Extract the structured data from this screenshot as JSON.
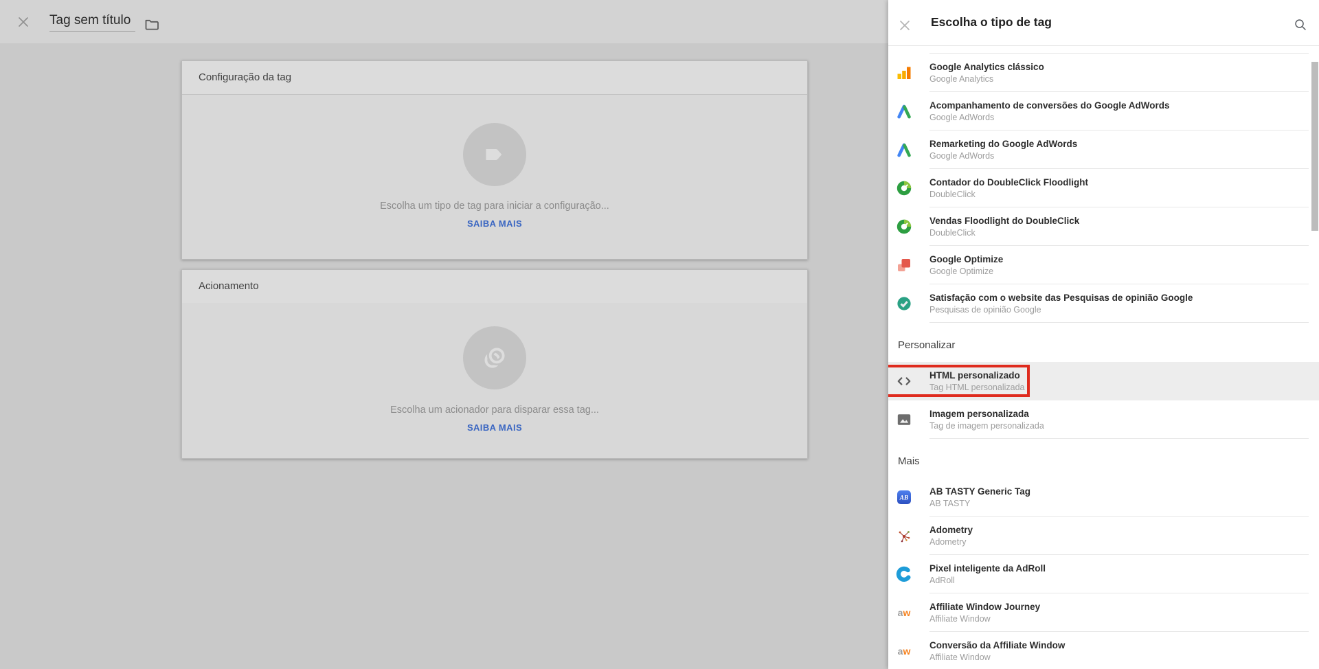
{
  "colors": {
    "accent_blue": "#3a66c2",
    "annotation_red": "#df2b1e",
    "highlight_row_bg": "#ededed"
  },
  "editor": {
    "title": "Tag sem título",
    "cards": [
      {
        "header": "Configuração da tag",
        "message": "Escolha um tipo de tag para iniciar a configuração...",
        "link_label": "SAIBA MAIS",
        "icon": "tag-icon"
      },
      {
        "header": "Acionamento",
        "message": "Escolha um acionador para disparar essa tag...",
        "link_label": "SAIBA MAIS",
        "icon": "trigger-icon"
      }
    ]
  },
  "panel": {
    "title": "Escolha o tipo de tag",
    "groups": [
      {
        "type": "rows",
        "rows": [
          {
            "title": "Google Analytics clássico",
            "subtitle": "Google Analytics",
            "icon": "ga-classic"
          },
          {
            "title": "Acompanhamento de conversões do Google AdWords",
            "subtitle": "Google AdWords",
            "icon": "adwords"
          },
          {
            "title": "Remarketing do Google AdWords",
            "subtitle": "Google AdWords",
            "icon": "adwords"
          },
          {
            "title": "Contador do DoubleClick Floodlight",
            "subtitle": "DoubleClick",
            "icon": "doubleclick"
          },
          {
            "title": "Vendas Floodlight do DoubleClick",
            "subtitle": "DoubleClick",
            "icon": "doubleclick"
          },
          {
            "title": "Google Optimize",
            "subtitle": "Google Optimize",
            "icon": "optimize"
          },
          {
            "title": "Satisfação com o website das Pesquisas de opinião Google",
            "subtitle": "Pesquisas de opinião Google",
            "icon": "surveys"
          }
        ]
      },
      {
        "type": "section",
        "label": "Personalizar"
      },
      {
        "type": "rows",
        "rows": [
          {
            "title": "HTML personalizado",
            "subtitle": "Tag HTML personalizada",
            "icon": "custom-html",
            "highlighted": true
          },
          {
            "title": "Imagem personalizada",
            "subtitle": "Tag de imagem personalizada",
            "icon": "custom-image"
          }
        ]
      },
      {
        "type": "section",
        "label": "Mais"
      },
      {
        "type": "rows",
        "rows": [
          {
            "title": "AB TASTY Generic Tag",
            "subtitle": "AB TASTY",
            "icon": "abtasty"
          },
          {
            "title": "Adometry",
            "subtitle": "Adometry",
            "icon": "adometry"
          },
          {
            "title": "Pixel inteligente da AdRoll",
            "subtitle": "AdRoll",
            "icon": "adroll"
          },
          {
            "title": "Affiliate Window Journey",
            "subtitle": "Affiliate Window",
            "icon": "aw"
          },
          {
            "title": "Conversão da Affiliate Window",
            "subtitle": "Affiliate Window",
            "icon": "aw"
          }
        ]
      }
    ]
  }
}
